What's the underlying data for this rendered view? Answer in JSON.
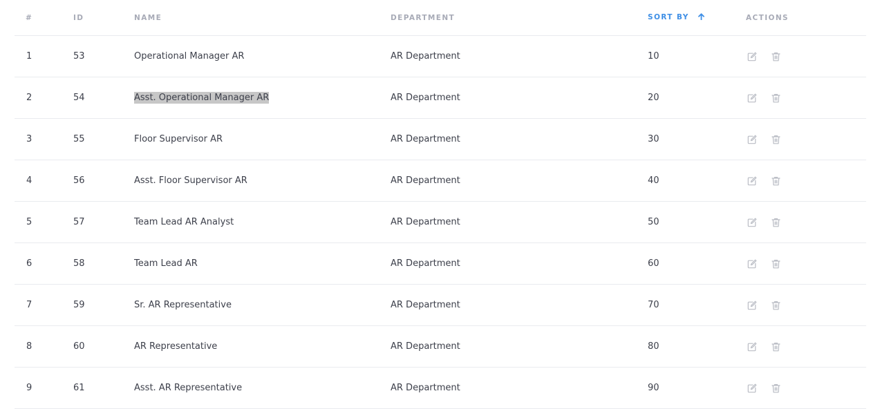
{
  "columns": {
    "num": "#",
    "id": "ID",
    "name": "NAME",
    "department": "DEPARTMENT",
    "sort_by": "SORT BY",
    "actions": "ACTIONS"
  },
  "sort": {
    "column": "sort_by",
    "direction": "ascending",
    "icon": "arrow-up-icon",
    "active_color": "#3f8fe6"
  },
  "selected_text": "Asst. Operational Manager AR",
  "row_icons": [
    "edit-icon",
    "trash-icon"
  ],
  "rows": [
    {
      "num": "1",
      "id": "53",
      "name": "Operational Manager AR",
      "department": "AR Department",
      "sort_by": "10"
    },
    {
      "num": "2",
      "id": "54",
      "name": "Asst. Operational Manager AR",
      "department": "AR Department",
      "sort_by": "20"
    },
    {
      "num": "3",
      "id": "55",
      "name": "Floor Supervisor AR",
      "department": "AR Department",
      "sort_by": "30"
    },
    {
      "num": "4",
      "id": "56",
      "name": "Asst. Floor Supervisor AR",
      "department": "AR Department",
      "sort_by": "40"
    },
    {
      "num": "5",
      "id": "57",
      "name": "Team Lead AR Analyst",
      "department": "AR Department",
      "sort_by": "50"
    },
    {
      "num": "6",
      "id": "58",
      "name": "Team Lead AR",
      "department": "AR Department",
      "sort_by": "60"
    },
    {
      "num": "7",
      "id": "59",
      "name": "Sr. AR Representative",
      "department": "AR Department",
      "sort_by": "70"
    },
    {
      "num": "8",
      "id": "60",
      "name": "AR Representative",
      "department": "AR Department",
      "sort_by": "80"
    },
    {
      "num": "9",
      "id": "61",
      "name": "Asst. AR Representative",
      "department": "AR Department",
      "sort_by": "90"
    }
  ]
}
